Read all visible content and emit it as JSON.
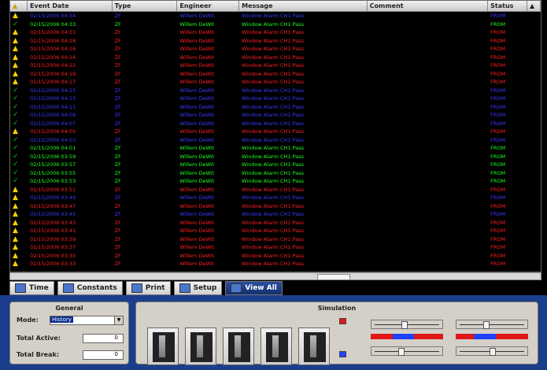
{
  "columns": [
    "",
    "Event Date",
    "Type",
    "Engineer",
    "Message",
    "Comment",
    "Status",
    ""
  ],
  "rows": [
    {
      "icon": "warn",
      "color": "blue",
      "date": "02/15/2006 04:34",
      "type": "ZF",
      "eng": "Willem DeWit",
      "msg": "Window Alarm CH1 Pass"
    },
    {
      "icon": "ok",
      "color": "green",
      "date": "02/15/2006 04:33",
      "type": "ZF",
      "eng": "Willem DeWit",
      "msg": "Window Alarm CH1 Pass"
    },
    {
      "icon": "warn",
      "color": "red",
      "date": "02/15/2006 04:31",
      "type": "ZF",
      "eng": "Willem DeWit",
      "msg": "Window Alarm CH1 Pass"
    },
    {
      "icon": "warn",
      "color": "red",
      "date": "02/15/2006 04:28",
      "type": "ZF",
      "eng": "Willem DeWit",
      "msg": "Window Alarm CH1 Pass"
    },
    {
      "icon": "warn",
      "color": "red",
      "date": "02/15/2006 04:26",
      "type": "ZF",
      "eng": "Willem DeWit",
      "msg": "Window Alarm CH1 Pass"
    },
    {
      "icon": "warn",
      "color": "red",
      "date": "02/15/2006 04:24",
      "type": "ZF",
      "eng": "Willem DeWit",
      "msg": "Window Alarm CH1 Pass"
    },
    {
      "icon": "warn",
      "color": "red",
      "date": "02/15/2006 04:22",
      "type": "ZF",
      "eng": "Willem DeWit",
      "msg": "Window Alarm CH1 Pass"
    },
    {
      "icon": "warn",
      "color": "red",
      "date": "02/15/2006 04:19",
      "type": "ZF",
      "eng": "Willem DeWit",
      "msg": "Window Alarm CH1 Pass"
    },
    {
      "icon": "warn",
      "color": "red",
      "date": "02/15/2006 04:17",
      "type": "ZF",
      "eng": "Willem DeWit",
      "msg": "Window Alarm CH1 Pass"
    },
    {
      "icon": "ok",
      "color": "blue",
      "date": "02/15/2006 04:15",
      "type": "ZF",
      "eng": "Willem DeWit",
      "msg": "Window Alarm CH1 Pass"
    },
    {
      "icon": "ok",
      "color": "blue",
      "date": "02/15/2006 04:13",
      "type": "ZF",
      "eng": "Willem DeWit",
      "msg": "Window Alarm CH1 Pass"
    },
    {
      "icon": "ok",
      "color": "blue",
      "date": "02/15/2006 04:11",
      "type": "ZF",
      "eng": "Willem DeWit",
      "msg": "Window Alarm CH1 Pass"
    },
    {
      "icon": "ok",
      "color": "blue",
      "date": "02/15/2006 04:09",
      "type": "ZF",
      "eng": "Willem DeWit",
      "msg": "Window Alarm CH1 Pass"
    },
    {
      "icon": "ok",
      "color": "blue",
      "date": "02/15/2006 04:07",
      "type": "ZF",
      "eng": "Willem DeWit",
      "msg": "Window Alarm CH1 Pass"
    },
    {
      "icon": "warn",
      "color": "red",
      "date": "02/15/2006 04:05",
      "type": "ZF",
      "eng": "Willem DeWit",
      "msg": "Window Alarm CH1 Pass"
    },
    {
      "icon": "ok",
      "color": "blue",
      "date": "02/15/2006 04:03",
      "type": "ZF",
      "eng": "Willem DeWit",
      "msg": "Window Alarm CH1 Pass"
    },
    {
      "icon": "ok",
      "color": "green",
      "date": "02/15/2006 04:01",
      "type": "ZF",
      "eng": "Willem DeWit",
      "msg": "Window Alarm CH1 Pass"
    },
    {
      "icon": "ok",
      "color": "green",
      "date": "02/15/2006 03:59",
      "type": "ZF",
      "eng": "Willem DeWit",
      "msg": "Window Alarm CH1 Pass"
    },
    {
      "icon": "ok",
      "color": "green",
      "date": "02/15/2006 03:57",
      "type": "ZF",
      "eng": "Willem DeWit",
      "msg": "Window Alarm CH1 Pass"
    },
    {
      "icon": "ok",
      "color": "green",
      "date": "02/15/2006 03:55",
      "type": "ZF",
      "eng": "Willem DeWit",
      "msg": "Window Alarm CH1 Pass"
    },
    {
      "icon": "ok",
      "color": "green",
      "date": "02/15/2006 03:53",
      "type": "ZF",
      "eng": "Willem DeWit",
      "msg": "Window Alarm CH1 Pass"
    },
    {
      "icon": "warn",
      "color": "red",
      "date": "02/15/2006 03:51",
      "type": "ZF",
      "eng": "Willem DeWit",
      "msg": "Window Alarm CH1 Pass"
    },
    {
      "icon": "warn",
      "color": "blue",
      "date": "02/15/2006 03:49",
      "type": "ZF",
      "eng": "Willem DeWit",
      "msg": "Window Alarm CH1 Pass"
    },
    {
      "icon": "warn",
      "color": "red",
      "date": "02/15/2006 03:47",
      "type": "ZF",
      "eng": "Willem DeWit",
      "msg": "Window Alarm CH1 Pass"
    },
    {
      "icon": "warn",
      "color": "blue",
      "date": "02/15/2006 03:45",
      "type": "ZF",
      "eng": "Willem DeWit",
      "msg": "Window Alarm CH1 Pass"
    },
    {
      "icon": "warn",
      "color": "red",
      "date": "02/15/2006 03:43",
      "type": "ZF",
      "eng": "Willem DeWit",
      "msg": "Window Alarm CH1 Pass"
    },
    {
      "icon": "warn",
      "color": "red",
      "date": "02/15/2006 03:41",
      "type": "ZF",
      "eng": "Willem DeWit",
      "msg": "Window Alarm CH1 Pass"
    },
    {
      "icon": "warn",
      "color": "red",
      "date": "02/15/2006 03:39",
      "type": "ZF",
      "eng": "Willem DeWit",
      "msg": "Window Alarm CH1 Pass"
    },
    {
      "icon": "warn",
      "color": "red",
      "date": "02/15/2006 03:37",
      "type": "ZF",
      "eng": "Willem DeWit",
      "msg": "Window Alarm CH1 Pass"
    },
    {
      "icon": "warn",
      "color": "red",
      "date": "02/15/2006 03:35",
      "type": "ZF",
      "eng": "Willem DeWit",
      "msg": "Window Alarm CH1 Pass"
    },
    {
      "icon": "warn",
      "color": "red",
      "date": "02/15/2006 03:33",
      "type": "ZF",
      "eng": "Willem DeWit",
      "msg": "Window Alarm CH1 Pass"
    }
  ],
  "status_text": {
    "red": "FROM",
    "green": "FROM",
    "blue": "FROM"
  },
  "tabs": [
    {
      "label": "Time",
      "icon": "clock-icon",
      "active": false
    },
    {
      "label": "Constants",
      "icon": "grid-icon",
      "active": false
    },
    {
      "label": "Print",
      "icon": "printer-icon",
      "active": false
    },
    {
      "label": "Setup",
      "icon": "wrench-icon",
      "active": false
    },
    {
      "label": "View All",
      "icon": "monitor-icon",
      "active": true
    }
  ],
  "general": {
    "title": "General",
    "mode_label": "Mode:",
    "mode_value": "History",
    "total_active_label": "Total Active:",
    "total_active_value": "0",
    "total_break_label": "Total Break:",
    "total_break_value": "0"
  },
  "simulation": {
    "title": "Simulation"
  },
  "colors": {
    "red": "#ff2020",
    "green": "#20ff20",
    "blue": "#3a3aff",
    "panel": "#d4d0c8",
    "bottom_bg": "#1a3e8c"
  },
  "levels": {
    "bar1_start": 0.3,
    "bar1_end": 0.6,
    "bar2_start": 0.25,
    "bar2_end": 0.55,
    "slider1": 0.45,
    "slider2": 0.4,
    "slider3": 0.4,
    "slider4": 0.5,
    "slider5": 0.35
  }
}
